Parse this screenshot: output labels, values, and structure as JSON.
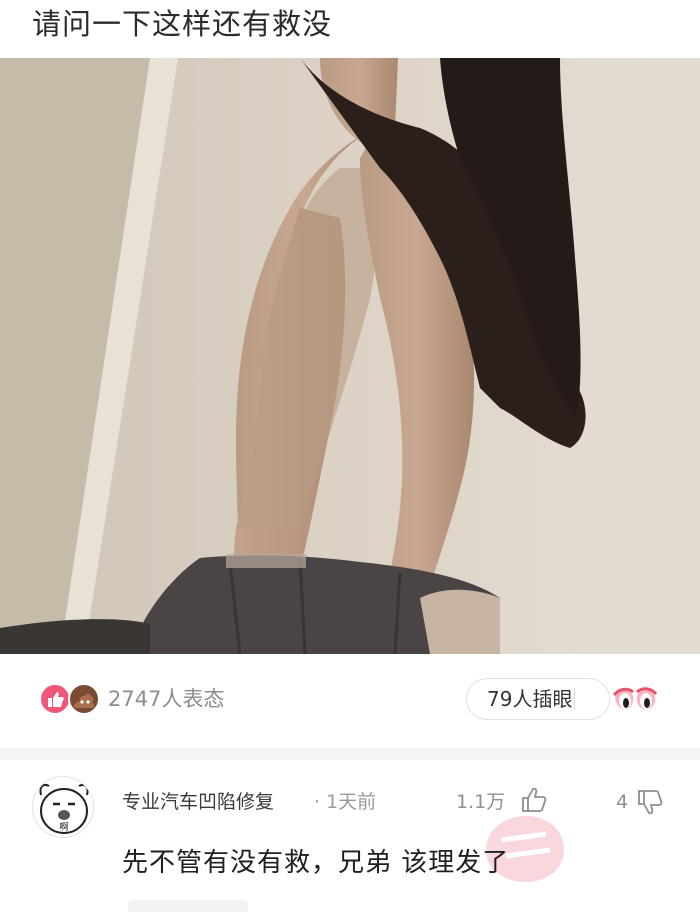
{
  "post": {
    "title": "请问一下这样还有救没"
  },
  "stats": {
    "reaction_count_text": "2747人表态",
    "poke_label": "79人插眼"
  },
  "comment": {
    "username": "专业汽车凹陷修复",
    "time": "· 1天前",
    "likes": "1.1万",
    "dislikes": "4",
    "text": "先不管有没有救，兄弟 该理发了",
    "avatar_text": "啊"
  },
  "colors": {
    "reaction_pink": "#f0567a",
    "reaction_brown": "#7a4a32",
    "badge_red": "#e8546a"
  },
  "icons": {
    "like": "thumbs-up-icon",
    "dislike": "thumbs-down-icon",
    "eyes": "eyes-icon"
  }
}
